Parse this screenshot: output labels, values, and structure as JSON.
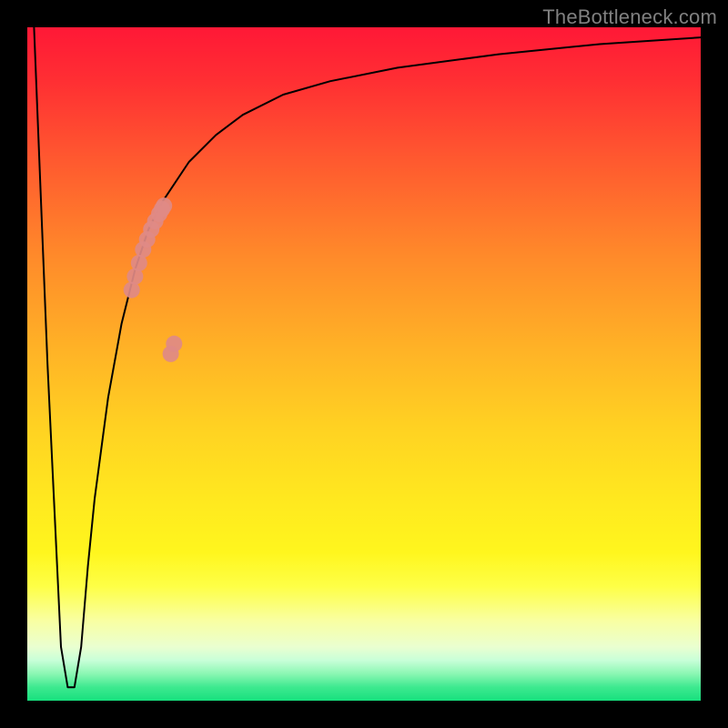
{
  "watermark": "TheBottleneck.com",
  "chart_data": {
    "type": "line",
    "title": "",
    "xlabel": "",
    "ylabel": "",
    "xlim": [
      0,
      100
    ],
    "ylim": [
      0,
      100
    ],
    "grid": false,
    "legend": false,
    "background_gradient": {
      "direction": "vertical",
      "stops": [
        {
          "pos": 0.0,
          "color": "#ff1836"
        },
        {
          "pos": 0.5,
          "color": "#ffb326"
        },
        {
          "pos": 0.8,
          "color": "#fff61e"
        },
        {
          "pos": 0.95,
          "color": "#8bf7b3"
        },
        {
          "pos": 1.0,
          "color": "#17e07e"
        }
      ]
    },
    "series": [
      {
        "name": "bottleneck-curve",
        "color": "#000000",
        "stroke_width": 2,
        "x": [
          1,
          3,
          5,
          6,
          7,
          8,
          9,
          10,
          12,
          14,
          16,
          18,
          20,
          24,
          28,
          32,
          38,
          45,
          55,
          70,
          85,
          100
        ],
        "y": [
          100,
          50,
          8,
          2,
          2,
          8,
          20,
          30,
          45,
          56,
          64,
          70,
          74,
          80,
          84,
          87,
          90,
          92,
          94,
          96,
          97.5,
          98.5
        ]
      },
      {
        "name": "highlight-dots",
        "type": "scatter",
        "color": "#e08a86",
        "marker_size": 9,
        "x": [
          15.5,
          16.0,
          16.6,
          17.2,
          17.8,
          18.4,
          19.0,
          19.6,
          20.0,
          20.3,
          21.3,
          21.8
        ],
        "y": [
          61,
          63,
          65,
          67,
          68.5,
          70,
          71.2,
          72.3,
          73,
          73.5,
          51.5,
          53
        ]
      }
    ],
    "annotations": []
  }
}
